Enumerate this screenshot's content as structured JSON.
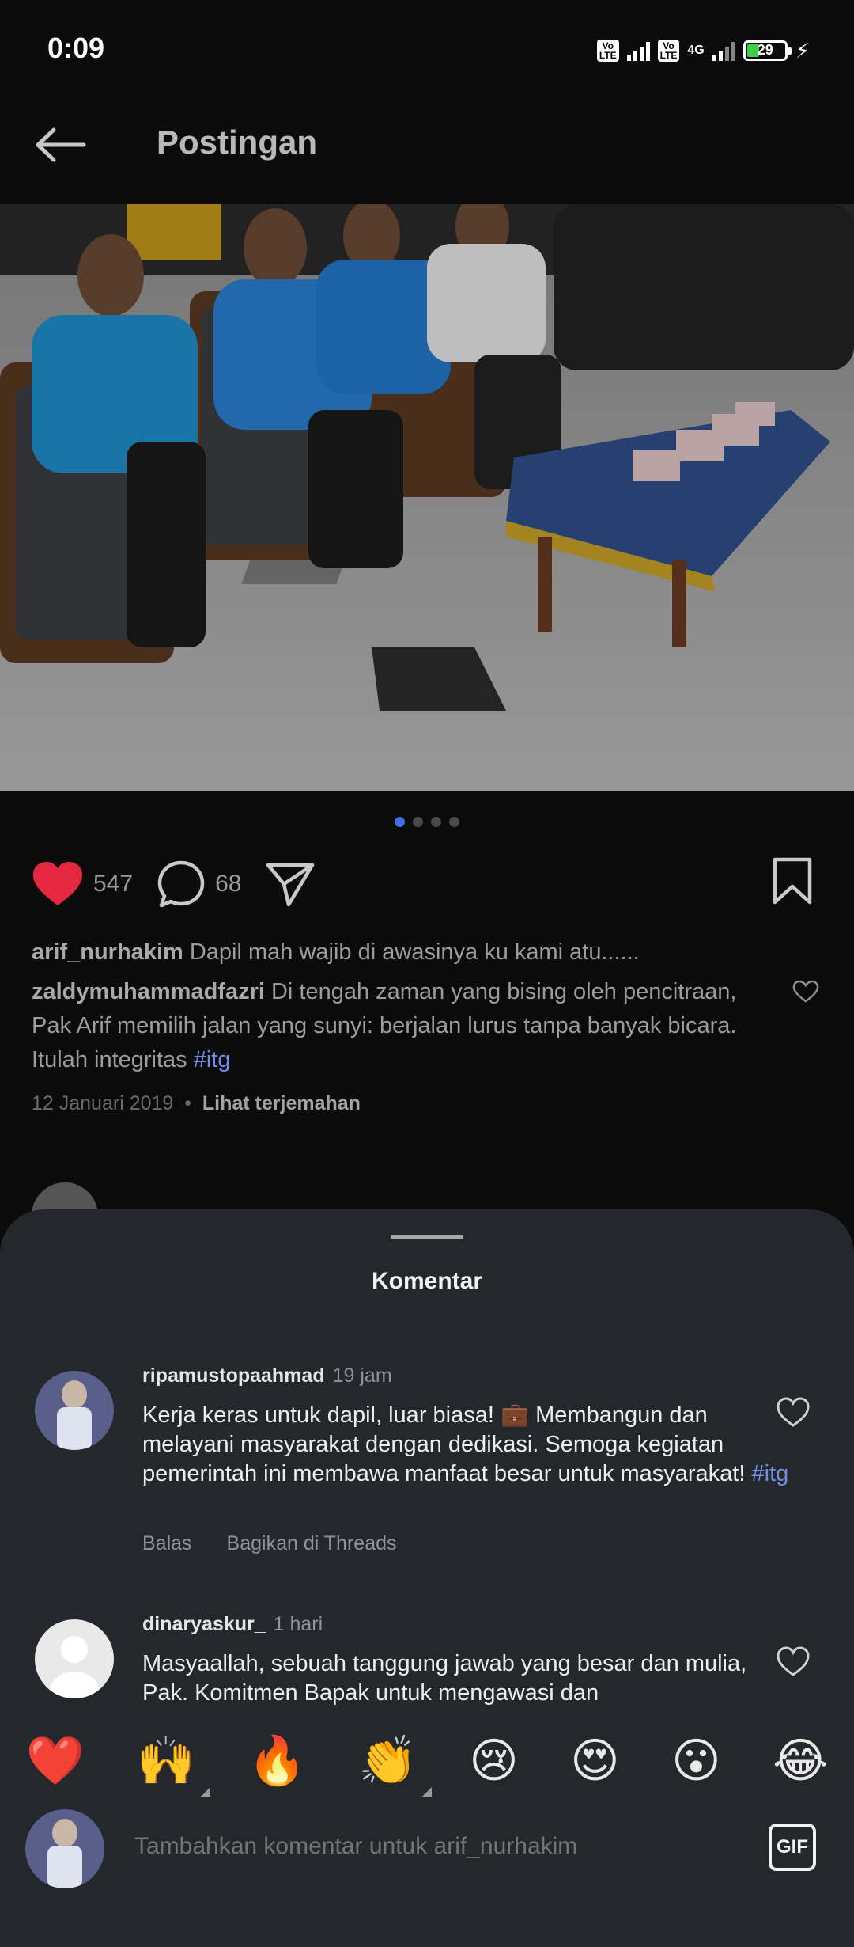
{
  "status_bar": {
    "time": "0:09",
    "sim1": "Vo LTE",
    "sim2": "Vo LTE",
    "network": "4G",
    "battery": "29",
    "battery_level": 0.29,
    "charging": true
  },
  "header": {
    "back_icon": "arrow-left-icon",
    "title": "Postingan"
  },
  "post": {
    "carousel": {
      "count": 4,
      "active_index": 0
    },
    "likes": "547",
    "comments": "68",
    "caption_user": "arif_nurhakim",
    "caption_text": "Dapil mah wajib di awasinya ku kami atu......",
    "top_comment_user": "zaldymuhammadfazri",
    "top_comment_text": "Di tengah zaman yang bising oleh pencitraan, Pak Arif memilih jalan yang sunyi: berjalan lurus tanpa banyak bicara. Itulah integritas",
    "top_comment_hashtag": "#itg",
    "date": "12 Januari 2019",
    "separator": "•",
    "translate": "Lihat terjemahan"
  },
  "sheet": {
    "title": "Komentar",
    "comments": [
      {
        "user": "ripamustopaahmad",
        "time": "19 jam",
        "text": "Kerja keras untuk dapil, luar biasa! 💼 Membangun dan melayani masyarakat dengan dedikasi. Semoga kegiatan pemerintah ini membawa manfaat besar untuk masyarakat!",
        "hashtag": "#itg",
        "reply": "Balas",
        "share": "Bagikan di Threads"
      },
      {
        "user": "dinaryaskur_",
        "time": "1 hari",
        "text": "Masyaallah, sebuah tanggung jawab yang besar dan mulia, Pak. Komitmen Bapak untuk mengawasi dan"
      }
    ],
    "emojis": [
      "❤️",
      "🙌",
      "🔥",
      "👏",
      "😢",
      "😍",
      "😮",
      "😂"
    ],
    "composer_placeholder": "Tambahkan komentar untuk arif_nurhakim",
    "gif_label": "GIF"
  },
  "colors": {
    "like_heart": "#e5283f",
    "hashtag": "#6f8fe6",
    "sheet_bg": "#24272b"
  }
}
